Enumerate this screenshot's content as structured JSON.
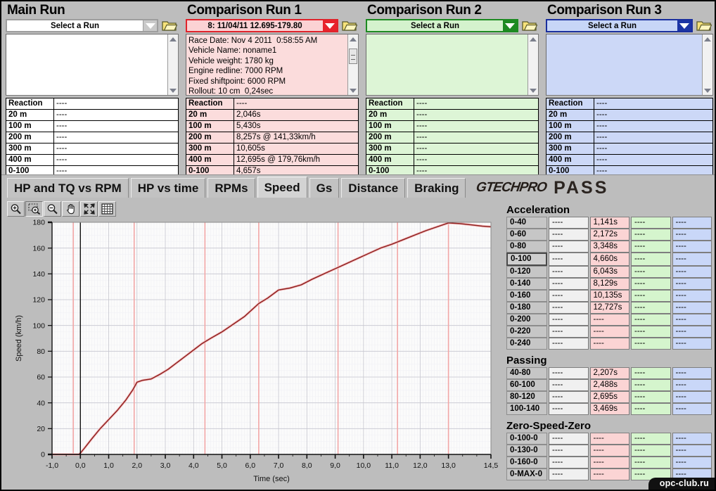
{
  "panels": [
    {
      "title": "Main Run",
      "theme": "th-main",
      "combo_value": "Select a Run",
      "info": "",
      "rows": [
        {
          "label": "Reaction",
          "value": "----"
        },
        {
          "label": "20 m",
          "value": "----"
        },
        {
          "label": "100 m",
          "value": "----"
        },
        {
          "label": "200 m",
          "value": "----"
        },
        {
          "label": "300 m",
          "value": "----"
        },
        {
          "label": "400 m",
          "value": "----"
        },
        {
          "label": "0-100",
          "value": "----"
        }
      ]
    },
    {
      "title": "Comparison Run 1",
      "theme": "th-r",
      "combo_value": "8:   11/04/11 12.695-179.80",
      "info": "Race Date: Nov 4 2011  0:58:55 AM\nVehicle Name: noname1\nVehicle weight: 1780 kg\nEngine redline: 7000 RPM\nFixed shiftpoint: 6000 RPM\nRollout: 10 cm  0,24sec",
      "rows": [
        {
          "label": "Reaction",
          "value": "----"
        },
        {
          "label": "20 m",
          "value": "2,046s"
        },
        {
          "label": "100 m",
          "value": "5,430s"
        },
        {
          "label": "200 m",
          "value": "8,257s @ 141,33km/h"
        },
        {
          "label": "300 m",
          "value": "10,605s"
        },
        {
          "label": "400 m",
          "value": "12,695s @ 179,76km/h"
        },
        {
          "label": "0-100",
          "value": "4,657s"
        }
      ]
    },
    {
      "title": "Comparison Run 2",
      "theme": "th-g",
      "combo_value": "Select a Run",
      "info": "",
      "rows": [
        {
          "label": "Reaction",
          "value": "----"
        },
        {
          "label": "20 m",
          "value": "----"
        },
        {
          "label": "100 m",
          "value": "----"
        },
        {
          "label": "200 m",
          "value": "----"
        },
        {
          "label": "300 m",
          "value": "----"
        },
        {
          "label": "400 m",
          "value": "----"
        },
        {
          "label": "0-100",
          "value": "----"
        }
      ]
    },
    {
      "title": "Comparison Run 3",
      "theme": "th-b",
      "combo_value": "Select a Run",
      "info": "",
      "rows": [
        {
          "label": "Reaction",
          "value": "----"
        },
        {
          "label": "20 m",
          "value": "----"
        },
        {
          "label": "100 m",
          "value": "----"
        },
        {
          "label": "200 m",
          "value": "----"
        },
        {
          "label": "300 m",
          "value": "----"
        },
        {
          "label": "400 m",
          "value": "----"
        },
        {
          "label": "0-100",
          "value": "----"
        }
      ]
    }
  ],
  "tabs": [
    {
      "label": "HP and TQ vs RPM",
      "selected": false
    },
    {
      "label": "HP vs time",
      "selected": false
    },
    {
      "label": "RPMs",
      "selected": false
    },
    {
      "label": "Speed",
      "selected": true
    },
    {
      "label": "Gs",
      "selected": false
    },
    {
      "label": "Distance",
      "selected": false
    },
    {
      "label": "Braking",
      "selected": false
    }
  ],
  "logo": {
    "part1": "GTECHPRO",
    "part2": "PASS"
  },
  "chart_tools": [
    {
      "name": "zoom-in-icon",
      "label": "Zoom In",
      "active": false
    },
    {
      "name": "zoom-box-icon",
      "label": "Zoom Box",
      "active": true
    },
    {
      "name": "zoom-out-icon",
      "label": "Zoom Out",
      "active": false
    },
    {
      "name": "pan-hand-icon",
      "label": "Pan",
      "active": false
    },
    {
      "name": "fit-screen-icon",
      "label": "Fit to Screen",
      "active": false
    },
    {
      "name": "grid-icon",
      "label": "Toggle Grid",
      "active": false
    }
  ],
  "chart_data": {
    "type": "line",
    "title": "",
    "xlabel": "Time (sec)",
    "ylabel": "Speed (km/h)",
    "xlim": [
      -1.0,
      14.5
    ],
    "ylim": [
      0,
      180
    ],
    "xticks": [
      "-1,0",
      "0,0",
      "1,0",
      "2,0",
      "3,0",
      "4,0",
      "5,0",
      "6,0",
      "7,0",
      "8,0",
      "9,0",
      "10,0",
      "11,0",
      "12,0",
      "13,0",
      "14,5"
    ],
    "xtick_values": [
      -1,
      0,
      1,
      2,
      3,
      4,
      5,
      6,
      7,
      8,
      9,
      10,
      11,
      12,
      13,
      14.5
    ],
    "yticks": [
      "0",
      "20",
      "40",
      "60",
      "80",
      "100",
      "120",
      "140",
      "160",
      "180"
    ],
    "ytick_values": [
      0,
      20,
      40,
      60,
      80,
      100,
      120,
      140,
      160,
      180
    ],
    "grid": true,
    "legend": "none",
    "series": [
      {
        "name": "Comparison Run 1 Speed",
        "color": "#8e2020",
        "x": [
          -1.0,
          -0.25,
          -0.05,
          0.0,
          0.15,
          0.4,
          0.7,
          1.0,
          1.3,
          1.6,
          1.85,
          2.0,
          2.2,
          2.5,
          2.8,
          3.1,
          3.4,
          3.7,
          4.0,
          4.3,
          4.6,
          5.0,
          5.4,
          5.8,
          6.1,
          6.3,
          6.6,
          7.0,
          7.4,
          7.8,
          8.2,
          8.6,
          9.0,
          9.4,
          9.8,
          10.2,
          10.6,
          11.0,
          11.4,
          11.8,
          12.2,
          12.6,
          13.0,
          13.4,
          13.8,
          14.2,
          14.5
        ],
        "y": [
          0,
          0,
          0,
          1,
          5,
          12,
          20,
          27,
          34,
          42,
          50,
          56,
          57.5,
          58.5,
          62,
          66,
          71,
          76,
          81,
          86,
          90,
          95,
          101,
          107,
          113,
          117,
          121,
          127.5,
          129,
          131.5,
          136,
          140,
          144,
          148,
          152,
          156,
          160,
          163,
          166.5,
          170,
          173.5,
          176.5,
          179.5,
          179,
          178,
          177,
          176.5
        ]
      }
    ],
    "cursor_lines": [
      {
        "x": 0.0,
        "color": "#000000",
        "name": "cursor"
      }
    ],
    "shift_lines": [
      {
        "x": -0.25,
        "color": "#f2a6a6"
      },
      {
        "x": 1.9,
        "color": "#f2a6a6"
      },
      {
        "x": 4.4,
        "color": "#f2a6a6"
      },
      {
        "x": 6.3,
        "color": "#f2a6a6"
      },
      {
        "x": 9.1,
        "color": "#f2a6a6"
      },
      {
        "x": 11.2,
        "color": "#f2a6a6"
      },
      {
        "x": 13.0,
        "color": "#f2a6a6"
      }
    ]
  },
  "stats": {
    "acceleration": {
      "title": "Acceleration",
      "rows": [
        {
          "label": "0-40",
          "selected": false,
          "values": [
            "----",
            "1,141s",
            "----",
            "----"
          ]
        },
        {
          "label": "0-60",
          "selected": false,
          "values": [
            "----",
            "2,172s",
            "----",
            "----"
          ]
        },
        {
          "label": "0-80",
          "selected": false,
          "values": [
            "----",
            "3,348s",
            "----",
            "----"
          ]
        },
        {
          "label": "0-100",
          "selected": true,
          "values": [
            "----",
            "4,660s",
            "----",
            "----"
          ]
        },
        {
          "label": "0-120",
          "selected": false,
          "values": [
            "----",
            "6,043s",
            "----",
            "----"
          ]
        },
        {
          "label": "0-140",
          "selected": false,
          "values": [
            "----",
            "8,129s",
            "----",
            "----"
          ]
        },
        {
          "label": "0-160",
          "selected": false,
          "values": [
            "----",
            "10,135s",
            "----",
            "----"
          ]
        },
        {
          "label": "0-180",
          "selected": false,
          "values": [
            "----",
            "12,727s",
            "----",
            "----"
          ]
        },
        {
          "label": "0-200",
          "selected": false,
          "values": [
            "----",
            "----",
            "----",
            "----"
          ]
        },
        {
          "label": "0-220",
          "selected": false,
          "values": [
            "----",
            "----",
            "----",
            "----"
          ]
        },
        {
          "label": "0-240",
          "selected": false,
          "values": [
            "----",
            "----",
            "----",
            "----"
          ]
        }
      ]
    },
    "passing": {
      "title": "Passing",
      "rows": [
        {
          "label": "40-80",
          "selected": false,
          "values": [
            "----",
            "2,207s",
            "----",
            "----"
          ]
        },
        {
          "label": "60-100",
          "selected": false,
          "values": [
            "----",
            "2,488s",
            "----",
            "----"
          ]
        },
        {
          "label": "80-120",
          "selected": false,
          "values": [
            "----",
            "2,695s",
            "----",
            "----"
          ]
        },
        {
          "label": "100-140",
          "selected": false,
          "values": [
            "----",
            "3,469s",
            "----",
            "----"
          ]
        }
      ]
    },
    "zero_speed_zero": {
      "title": "Zero-Speed-Zero",
      "rows": [
        {
          "label": "0-100-0",
          "selected": false,
          "values": [
            "----",
            "----",
            "----",
            "----"
          ]
        },
        {
          "label": "0-130-0",
          "selected": false,
          "values": [
            "----",
            "----",
            "----",
            "----"
          ]
        },
        {
          "label": "0-160-0",
          "selected": false,
          "values": [
            "----",
            "----",
            "----",
            "----"
          ]
        },
        {
          "label": "0-MAX-0",
          "selected": false,
          "values": [
            "----",
            "----",
            "----",
            "----"
          ]
        }
      ]
    }
  },
  "watermark": "opc-club.ru"
}
